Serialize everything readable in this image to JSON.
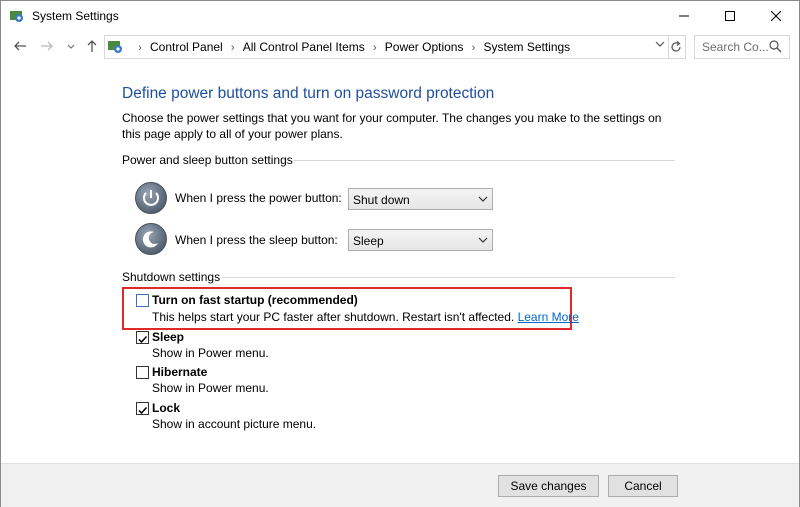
{
  "window": {
    "title": "System Settings"
  },
  "address": {
    "crumbs": [
      "Control Panel",
      "All Control Panel Items",
      "Power Options",
      "System Settings"
    ],
    "search_placeholder": "Search Co..."
  },
  "page": {
    "heading": "Define power buttons and turn on password protection",
    "description": "Choose the power settings that you want for your computer. The changes you make to the settings on this page apply to all of your power plans.",
    "power_group": {
      "label": "Power and sleep button settings",
      "power_label": "When I press the power button:",
      "power_value": "Shut down",
      "sleep_label": "When I press the sleep button:",
      "sleep_value": "Sleep"
    },
    "shutdown_group": {
      "label": "Shutdown settings",
      "options": [
        {
          "title": "Turn on fast startup (recommended)",
          "desc": "This helps start your PC faster after shutdown. Restart isn't affected.",
          "link": "Learn More",
          "checked": false
        },
        {
          "title": "Sleep",
          "desc": "Show in Power menu.",
          "checked": true
        },
        {
          "title": "Hibernate",
          "desc": "Show in Power menu.",
          "checked": false
        },
        {
          "title": "Lock",
          "desc": "Show in account picture menu.",
          "checked": true
        }
      ]
    }
  },
  "footer": {
    "save_label": "Save changes",
    "cancel_label": "Cancel"
  },
  "colors": {
    "heading": "#1e4e9d",
    "highlight": "#e0292a",
    "link": "#0066cc"
  }
}
